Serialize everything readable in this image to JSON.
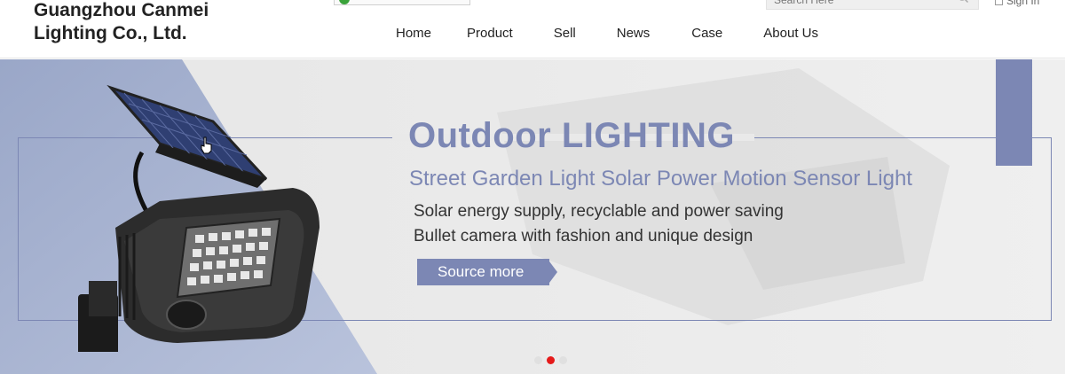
{
  "header": {
    "company_line1": "Guangzhou Canmei",
    "company_line2": "Lighting Co., Ltd.",
    "search_placeholder": "Search Here",
    "signin_label": "Sign In",
    "nav": [
      "Home",
      "Product",
      "Sell",
      "News",
      "Case",
      "About Us"
    ]
  },
  "banner": {
    "title": "Outdoor LIGHTING",
    "subtitle": "Street Garden Light Solar Power Motion Sensor Light",
    "line1": "Solar energy supply, recyclable and power saving",
    "line2": "Bullet camera with fashion and unique design",
    "cta_label": "Source more",
    "slides_total": 3,
    "active_slide": 2
  },
  "colors": {
    "accent": "#7c87b4",
    "dot_active": "#e51a1a",
    "text_dark": "#222222"
  },
  "icons": [
    "search-icon",
    "checkbox-icon",
    "globe-icon",
    "pointer-cursor-icon"
  ]
}
